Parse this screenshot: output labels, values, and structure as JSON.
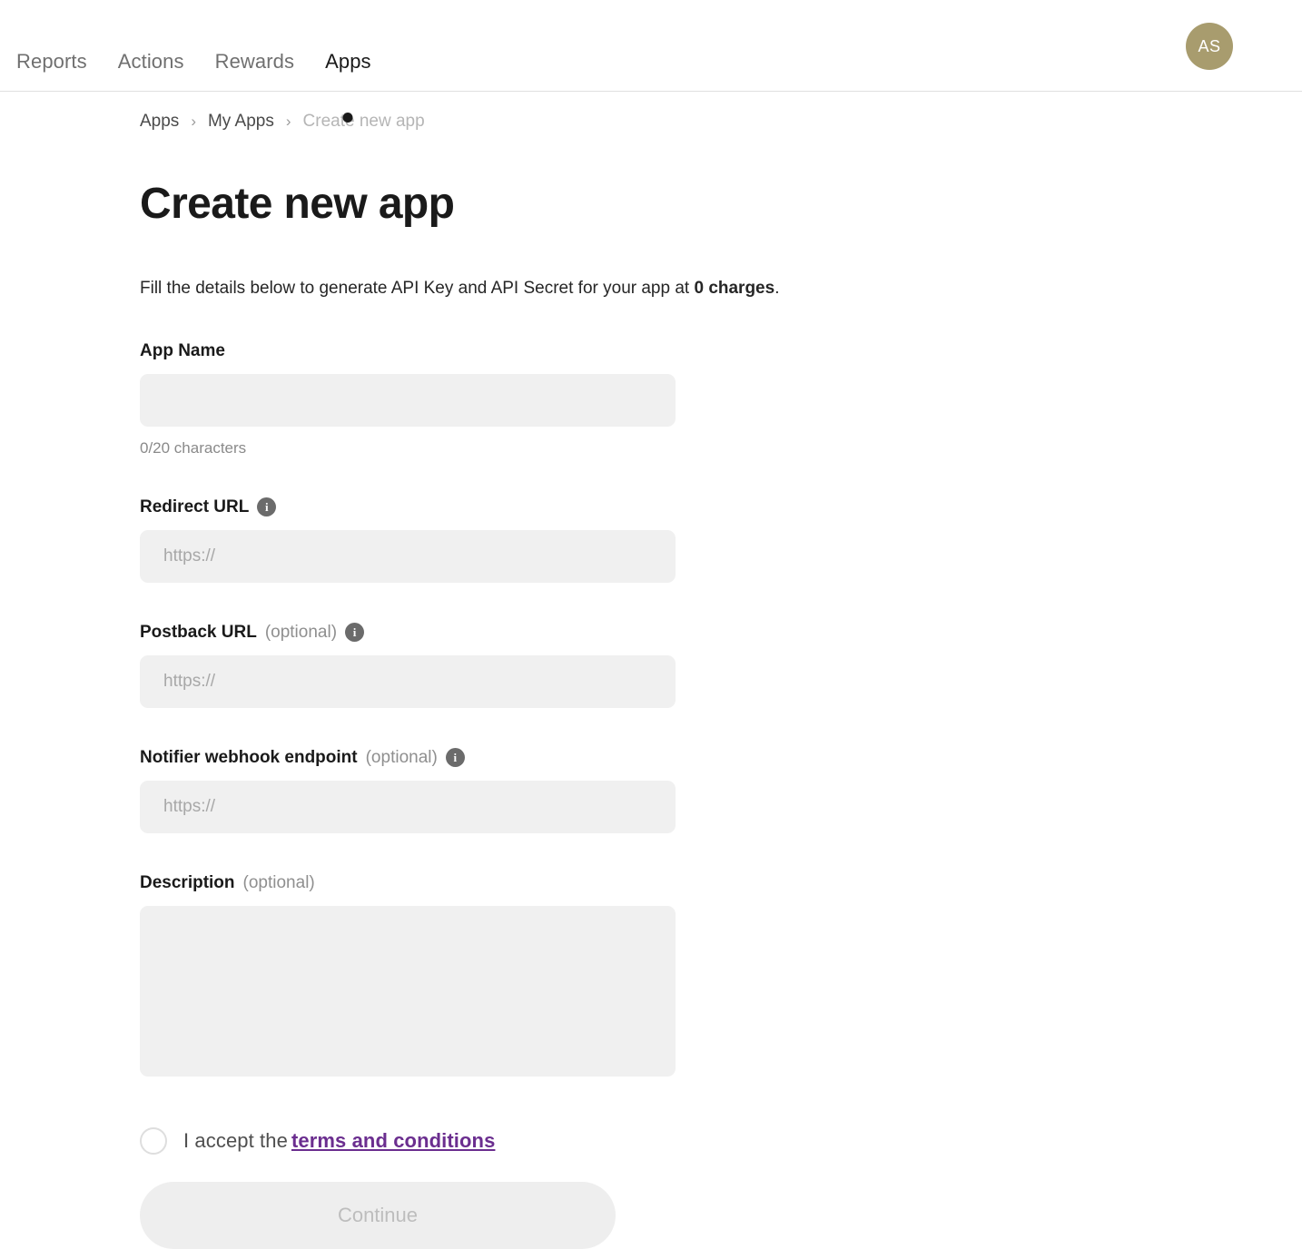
{
  "header": {
    "nav_tabs": [
      {
        "label": "Reports",
        "active": false
      },
      {
        "label": "Actions",
        "active": false
      },
      {
        "label": "Rewards",
        "active": false
      },
      {
        "label": "Apps",
        "active": true
      }
    ],
    "avatar_initials": "AS"
  },
  "breadcrumb": {
    "items": [
      {
        "label": "Apps",
        "current": false
      },
      {
        "label": "My Apps",
        "current": false
      },
      {
        "label": "Create new app",
        "current": true
      }
    ],
    "separator": "›"
  },
  "page": {
    "title": "Create new app",
    "description_prefix": "Fill the details below to generate API Key and API Secret for your app at ",
    "description_bold": "0 charges",
    "description_suffix": "."
  },
  "form": {
    "app_name": {
      "label": "App Name",
      "value": "",
      "placeholder": "",
      "char_count": "0/20 characters"
    },
    "redirect_url": {
      "label": "Redirect URL",
      "optional": "",
      "value": "",
      "placeholder": "https://",
      "info_glyph": "i"
    },
    "postback_url": {
      "label": "Postback URL",
      "optional": "(optional)",
      "value": "",
      "placeholder": "https://",
      "info_glyph": "i"
    },
    "notifier_webhook": {
      "label": "Notifier webhook endpoint",
      "optional": "(optional)",
      "value": "",
      "placeholder": "https://",
      "info_glyph": "i"
    },
    "description": {
      "label": "Description",
      "optional": "(optional)",
      "value": "",
      "placeholder": ""
    },
    "terms": {
      "accept_text": "I accept the",
      "link_text": "terms and conditions",
      "checked": false
    },
    "submit": {
      "label": "Continue",
      "disabled": true
    }
  },
  "colors": {
    "accent_link": "#6b2e8f",
    "avatar_bg": "#a89c6e",
    "input_bg": "#f0f0f0",
    "button_disabled_bg": "#eeeeee"
  }
}
